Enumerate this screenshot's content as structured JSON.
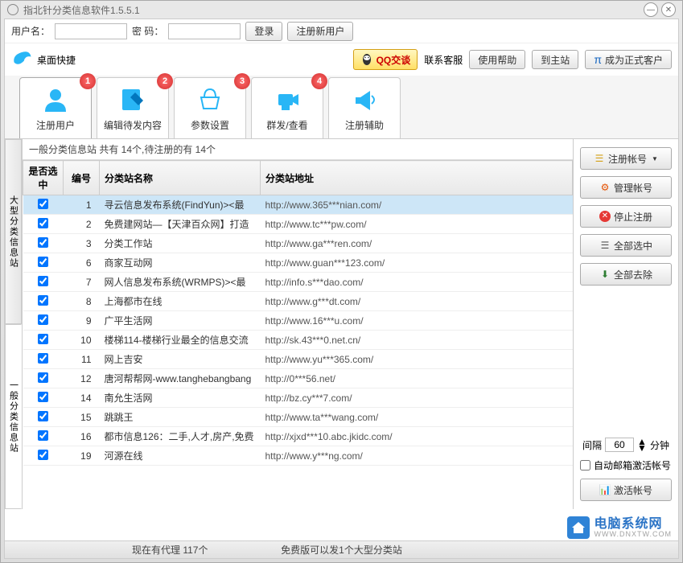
{
  "window": {
    "title": "指北针分类信息软件1.5.5.1"
  },
  "login": {
    "user_label": "用户名：",
    "pass_label": "密   码：",
    "login_btn": "登录",
    "register_btn": "注册新用户"
  },
  "toolbar": {
    "desktop_shortcut": "桌面快捷",
    "qq_label": "QQ交谈",
    "contact_label": "联系客服",
    "help_btn": "使用帮助",
    "main_site_btn": "到主站",
    "become_client_btn": "成为正式客户"
  },
  "nav": [
    {
      "label": "注册用户",
      "badge": "1"
    },
    {
      "label": "编辑待发内容",
      "badge": "2"
    },
    {
      "label": "参数设置",
      "badge": "3"
    },
    {
      "label": "群发/查看",
      "badge": "4"
    },
    {
      "label": "注册辅助",
      "badge": ""
    }
  ],
  "side_tabs": {
    "top": "大型分类信息站",
    "bottom": "一般分类信息站"
  },
  "table": {
    "caption": "一般分类信息站 共有 14个,待注册的有 14个",
    "headers": {
      "check": "是否选中",
      "num": "编号",
      "name": "分类站名称",
      "url": "分类站地址"
    },
    "rows": [
      {
        "num": "1",
        "name": "寻云信息发布系统(FindYun)><最",
        "url": "http://www.365***nian.com/",
        "selected": true
      },
      {
        "num": "2",
        "name": "免费建网站—【天津百众网】打造",
        "url": "http://www.tc***pw.com/"
      },
      {
        "num": "3",
        "name": "分类工作站",
        "url": "http://www.ga***ren.com/"
      },
      {
        "num": "6",
        "name": "商家互动网",
        "url": "http://www.guan***123.com/"
      },
      {
        "num": "7",
        "name": "网人信息发布系统(WRMPS)><最",
        "url": "http://info.s***dao.com/"
      },
      {
        "num": "8",
        "name": "上海都市在线",
        "url": "http://www.g***dt.com/"
      },
      {
        "num": "9",
        "name": "广平生活网",
        "url": "http://www.16***u.com/"
      },
      {
        "num": "10",
        "name": "楼梯114-楼梯行业最全的信息交流",
        "url": "http://sk.43***0.net.cn/"
      },
      {
        "num": "11",
        "name": "网上吉安",
        "url": "http://www.yu***365.com/"
      },
      {
        "num": "12",
        "name": "唐河帮帮网-www.tanghebangbang",
        "url": "http://0***56.net/"
      },
      {
        "num": "14",
        "name": "南允生活网",
        "url": "http://bz.cy***7.com/"
      },
      {
        "num": "15",
        "name": "跳跳王",
        "url": "http://www.ta***wang.com/"
      },
      {
        "num": "16",
        "name": "都市信息126：二手,人才,房产,免费",
        "url": "http://xjxd***10.abc.jkidc.com/"
      },
      {
        "num": "19",
        "name": "河源在线",
        "url": "http://www.y***ng.com/"
      }
    ]
  },
  "right_panel": {
    "register_account": "注册帐号",
    "manage_account": "管理帐号",
    "stop_register": "停止注册",
    "select_all": "全部选中",
    "remove_all": "全部去除",
    "interval_label": "间隔",
    "interval_value": "60",
    "interval_unit": "分钟",
    "auto_email": "自动邮箱激活帐号",
    "activate_account": "激活帐号"
  },
  "status": {
    "left": "现在有代理 117个",
    "center": "免费版可以发1个大型分类站"
  },
  "watermark": {
    "text": "电脑系统网",
    "sub": "WWW.DNXTW.COM"
  }
}
